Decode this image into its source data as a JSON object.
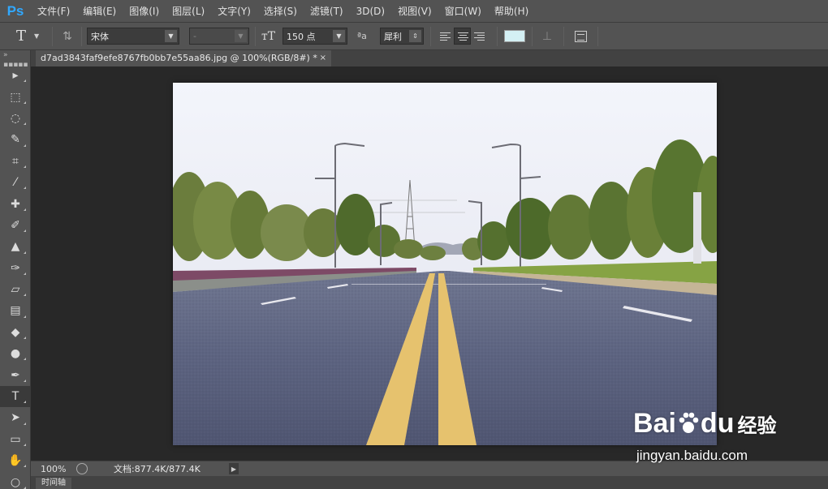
{
  "app": {
    "logo": "Ps"
  },
  "menu": [
    {
      "label": "文件(F)"
    },
    {
      "label": "编辑(E)"
    },
    {
      "label": "图像(I)"
    },
    {
      "label": "图层(L)"
    },
    {
      "label": "文字(Y)"
    },
    {
      "label": "选择(S)"
    },
    {
      "label": "滤镜(T)"
    },
    {
      "label": "3D(D)"
    },
    {
      "label": "视图(V)"
    },
    {
      "label": "窗口(W)"
    },
    {
      "label": "帮助(H)"
    }
  ],
  "options": {
    "tool_glyph": "T",
    "font_family": "宋体",
    "font_style": "-",
    "font_size": "150 点",
    "aa_icon": "ªa",
    "antialias": "犀利",
    "text_color": "#d4f0f4"
  },
  "document": {
    "tab_title": "d7ad3843faf9efe8767fb0bb7e55aa86.jpg @ 100%(RGB/8#) *",
    "close": "×"
  },
  "status": {
    "zoom": "100%",
    "doc_info": "文档:877.4K/877.4K"
  },
  "timeline": {
    "tab": "时间轴"
  },
  "watermark": {
    "brand_left": "Bai",
    "brand_right": "du",
    "product": "经验",
    "url": "jingyan.baidu.com"
  },
  "tools": [
    {
      "name": "move-tool-icon",
      "glyph": "▸"
    },
    {
      "name": "marquee-tool-icon",
      "glyph": "⬚"
    },
    {
      "name": "lasso-tool-icon",
      "glyph": "◌"
    },
    {
      "name": "quick-select-tool-icon",
      "glyph": "✎"
    },
    {
      "name": "crop-tool-icon",
      "glyph": "⌗"
    },
    {
      "name": "eyedropper-tool-icon",
      "glyph": "⁄"
    },
    {
      "name": "healing-brush-tool-icon",
      "glyph": "✚"
    },
    {
      "name": "brush-tool-icon",
      "glyph": "✐"
    },
    {
      "name": "stamp-tool-icon",
      "glyph": "▲"
    },
    {
      "name": "history-brush-tool-icon",
      "glyph": "✑"
    },
    {
      "name": "eraser-tool-icon",
      "glyph": "▱"
    },
    {
      "name": "gradient-tool-icon",
      "glyph": "▤"
    },
    {
      "name": "blur-tool-icon",
      "glyph": "◆"
    },
    {
      "name": "dodge-tool-icon",
      "glyph": "●"
    },
    {
      "name": "pen-tool-icon",
      "glyph": "✒"
    },
    {
      "name": "type-tool-icon",
      "glyph": "T"
    },
    {
      "name": "path-select-tool-icon",
      "glyph": "➤"
    },
    {
      "name": "rectangle-tool-icon",
      "glyph": "▭"
    },
    {
      "name": "hand-tool-icon",
      "glyph": "✋"
    },
    {
      "name": "zoom-tool-icon",
      "glyph": "○"
    }
  ]
}
